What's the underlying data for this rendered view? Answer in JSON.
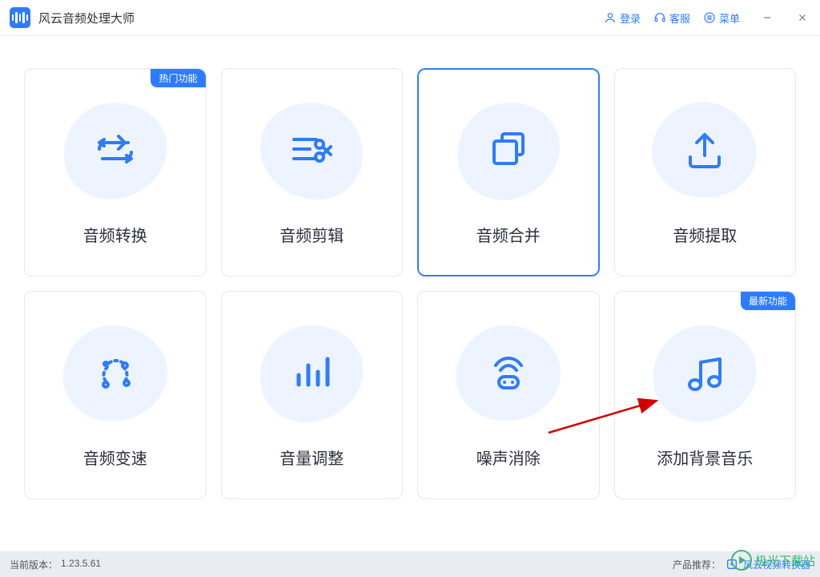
{
  "app": {
    "title": "风云音频处理大师"
  },
  "titlebar": {
    "login": "登录",
    "support": "客服",
    "menu": "菜单"
  },
  "badges": {
    "hot": "热门功能",
    "new": "最新功能"
  },
  "cards": [
    {
      "label": "音频转换",
      "icon": "swap-icon",
      "badge": "hot",
      "active": false
    },
    {
      "label": "音频剪辑",
      "icon": "cut-icon",
      "badge": null,
      "active": false
    },
    {
      "label": "音频合并",
      "icon": "merge-icon",
      "badge": null,
      "active": true
    },
    {
      "label": "音频提取",
      "icon": "extract-icon",
      "badge": null,
      "active": false
    },
    {
      "label": "音频变速",
      "icon": "speed-icon",
      "badge": null,
      "active": false
    },
    {
      "label": "音量调整",
      "icon": "volume-icon",
      "badge": null,
      "active": false
    },
    {
      "label": "噪声消除",
      "icon": "denoise-icon",
      "badge": null,
      "active": false
    },
    {
      "label": "添加背景音乐",
      "icon": "music-icon",
      "badge": "new",
      "active": false
    }
  ],
  "footer": {
    "version_label": "当前版本：",
    "version": "1.23.5.61",
    "recommend_label": "产品推荐：",
    "recommend_product": "风云视频转换器"
  },
  "watermark": {
    "text": "极光下载站"
  },
  "colors": {
    "accent": "#2d7cff",
    "blob": "#eef4ff"
  }
}
